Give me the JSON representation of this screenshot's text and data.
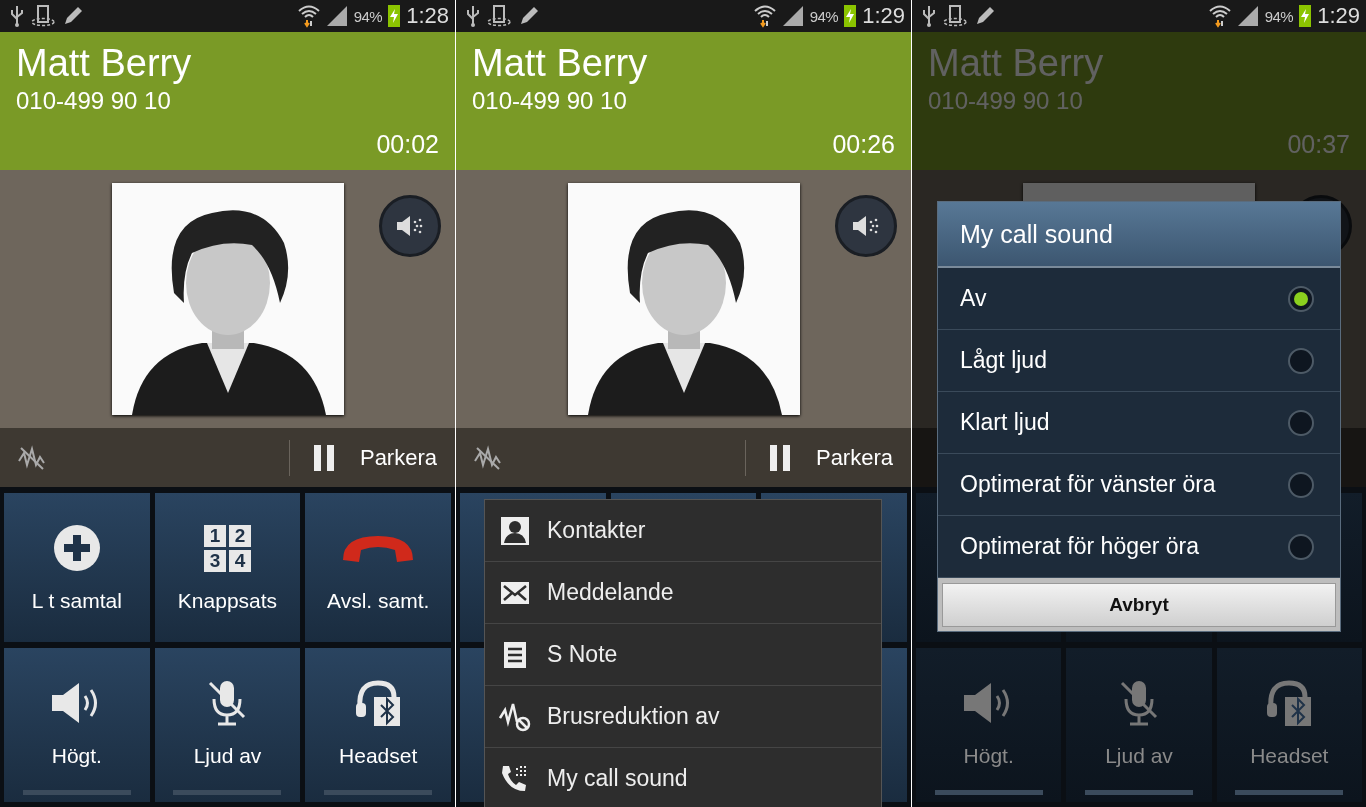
{
  "panels": [
    {
      "status_bar": {
        "battery": "94%",
        "time": "1:28"
      },
      "call": {
        "name": "Matt Berry",
        "number": "010-499 90 10",
        "duration": "00:02"
      },
      "photo": {
        "kind": "picture"
      },
      "action_bar": {
        "hold_label": "Parkera"
      },
      "dimmed": false,
      "buttons": [
        {
          "kind": "add",
          "label": "L t samtal"
        },
        {
          "kind": "keypad",
          "label": "Knappsats",
          "icon_digits": [
            "1",
            "2",
            "3",
            "4"
          ]
        },
        {
          "kind": "end-call",
          "label": "Avsl. samt."
        },
        {
          "kind": "speaker",
          "label": "Högt.",
          "on": false
        },
        {
          "kind": "mute",
          "label": "Ljud av",
          "on": false
        },
        {
          "kind": "headset",
          "label": "Headset",
          "on": false
        }
      ]
    },
    {
      "status_bar": {
        "battery": "94%",
        "time": "1:29"
      },
      "call": {
        "name": "Matt Berry",
        "number": "010-499 90 10",
        "duration": "00:26"
      },
      "photo": {
        "kind": "picture"
      },
      "action_bar": {
        "hold_label": "Parkera"
      },
      "dimmed": false,
      "menu": {
        "items": [
          {
            "kind": "contact",
            "label": "Kontakter"
          },
          {
            "kind": "message",
            "label": "Meddelande"
          },
          {
            "kind": "note",
            "label": "S Note"
          },
          {
            "kind": "noise",
            "label": "Brusreduktion av"
          },
          {
            "kind": "call-sound",
            "label": "My call sound"
          }
        ]
      }
    },
    {
      "status_bar": {
        "battery": "94%",
        "time": "1:29"
      },
      "call": {
        "name": "Matt Berry",
        "number": "010-499 90 10",
        "duration": "00:37"
      },
      "photo": {
        "kind": "picture"
      },
      "dimmed": true,
      "buttons": [
        {
          "kind": "speaker",
          "label": "Högt.",
          "on": false
        },
        {
          "kind": "mute",
          "label": "Ljud av",
          "on": false
        },
        {
          "kind": "headset",
          "label": "Headset",
          "on": false
        }
      ],
      "dialog": {
        "title": "My call sound",
        "cancel": "Avbryt",
        "options": [
          {
            "label": "Av",
            "selected": true
          },
          {
            "label": "Lågt ljud",
            "selected": false
          },
          {
            "label": "Klart ljud",
            "selected": false
          },
          {
            "label": "Optimerat för vänster öra",
            "selected": false
          },
          {
            "label": "Optimerat för höger öra",
            "selected": false
          }
        ]
      }
    }
  ]
}
